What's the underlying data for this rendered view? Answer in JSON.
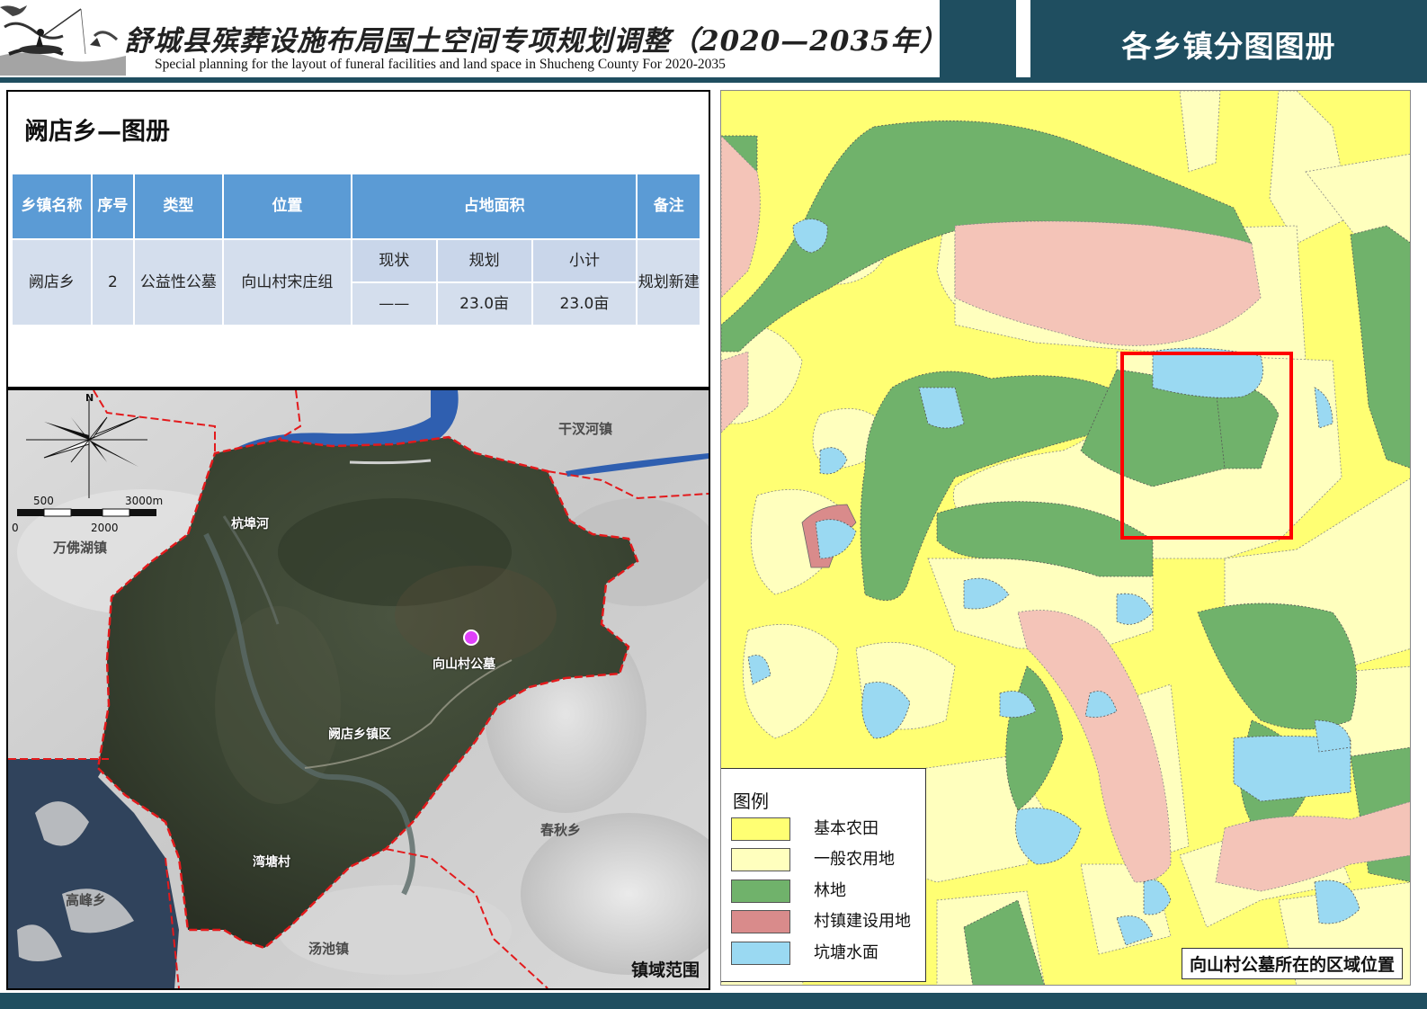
{
  "header": {
    "title_cn": "舒城县殡葬设施布局国土空间专项规划调整（2020—2035年）",
    "title_en": "Special planning for the layout of funeral facilities and land space in Shucheng County For 2020-2035",
    "section_title": "各乡镇分图图册"
  },
  "page_title": "阙店乡—图册",
  "table": {
    "headers": {
      "town": "乡镇名称",
      "index": "序号",
      "type": "类型",
      "location": "位置",
      "area": "占地面积",
      "remark": "备注"
    },
    "subheaders": {
      "current": "现状",
      "planned": "规划",
      "subtotal": "小计"
    },
    "row": {
      "town": "阙店乡",
      "index": "2",
      "type": "公益性公墓",
      "location": "向山村宋庄组",
      "current": "——",
      "planned": "23.0亩",
      "subtotal": "23.0亩",
      "remark": "规划新建"
    }
  },
  "town_map": {
    "caption": "镇域范围",
    "north_label": "N",
    "scale": {
      "top_left": "500",
      "top_right": "3000m",
      "bottom_left": "0",
      "bottom_mid": "2000"
    },
    "labels": {
      "ganhan": "干汊河镇",
      "hangbu": "杭埠河",
      "wanfo": "万佛湖镇",
      "xiangshan": "向山村公墓",
      "quedian": "阙店乡镇区",
      "chunqiu": "春秋乡",
      "wantang": "湾塘村",
      "gaofeng": "高峰乡",
      "tangchi": "汤池镇"
    },
    "colors": {
      "boundary": "#e31a1c",
      "river": "#2a5aa8",
      "cemetery_marker": "#e040fb",
      "town_area": "#3a4432"
    }
  },
  "landuse_map": {
    "caption": "向山村公墓所在的区域位置",
    "legend_title": "图例",
    "legend": [
      {
        "label": "基本农田",
        "color": "#ffff73"
      },
      {
        "label": "一般农用地",
        "color": "#ffffbe"
      },
      {
        "label": "林地",
        "color": "#70b26b"
      },
      {
        "label": "村镇建设用地",
        "color": "#d98b8b"
      },
      {
        "label": "坑塘水面",
        "color": "#9ad9f2"
      }
    ],
    "highlight_color": "#ff0000",
    "planning_color": "#f4c4b8"
  }
}
